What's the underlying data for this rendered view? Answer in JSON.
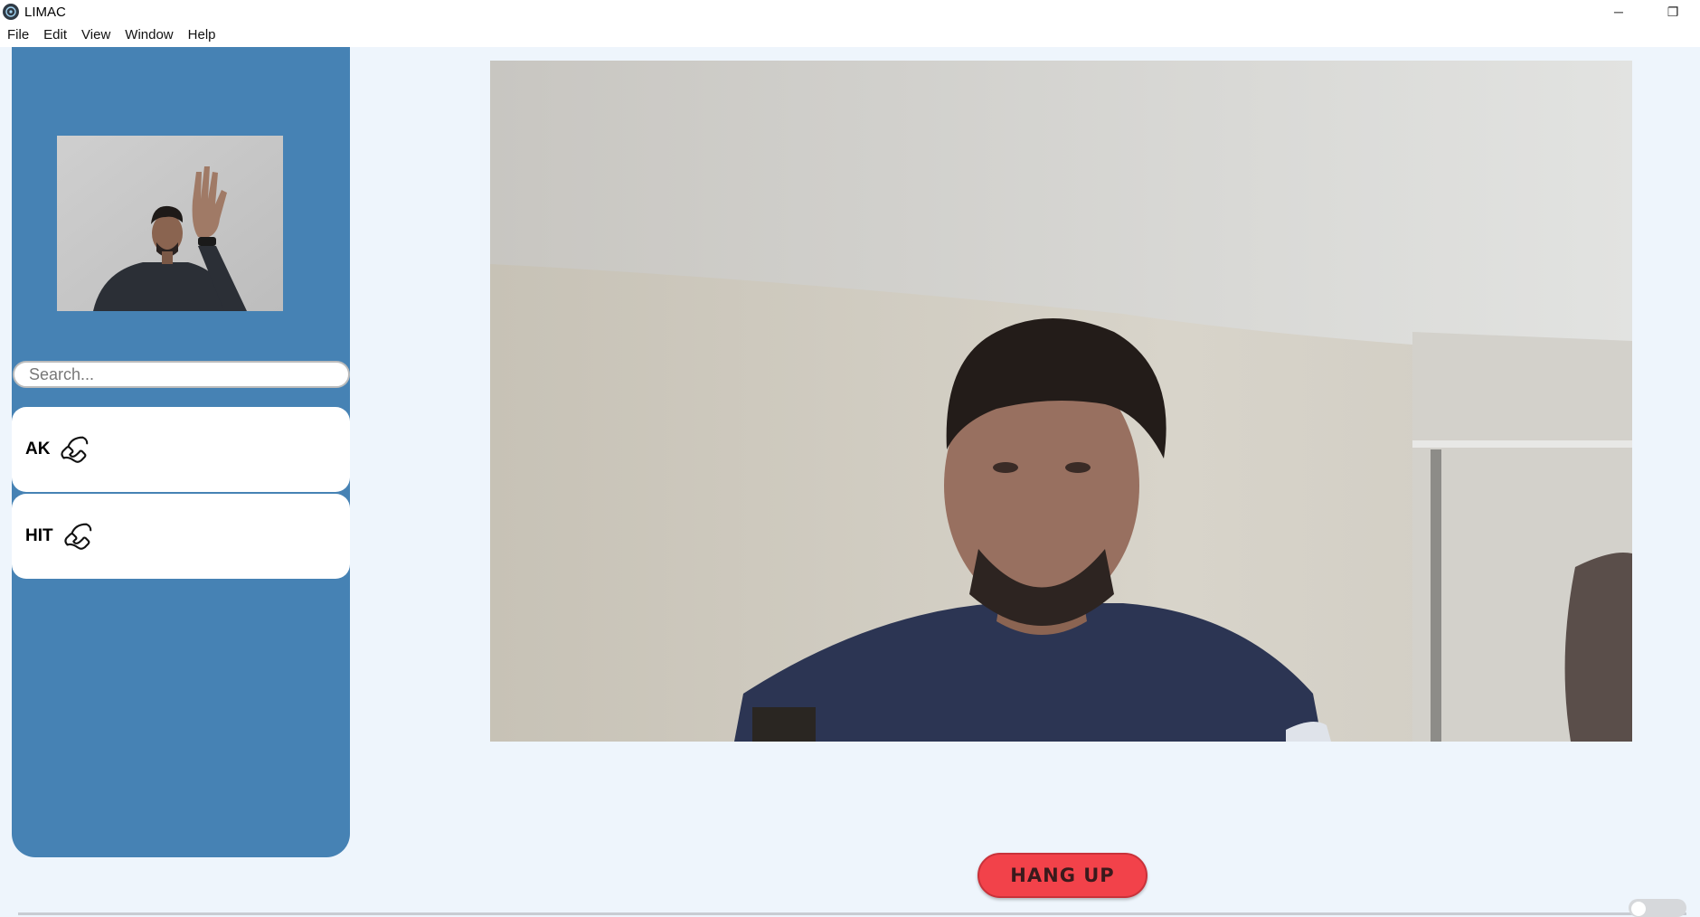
{
  "app": {
    "title": "LIMAC"
  },
  "window_controls": {
    "minimize": "─",
    "restore": "❐"
  },
  "menu": {
    "items": [
      "File",
      "Edit",
      "View",
      "Window",
      "Help"
    ]
  },
  "sidebar": {
    "search_placeholder": "Search...",
    "contacts": [
      {
        "name": "AK",
        "icon": "phone-icon"
      },
      {
        "name": "HIT",
        "icon": "phone-icon"
      }
    ]
  },
  "call": {
    "hangup_label": "HANG UP"
  },
  "colors": {
    "sidebar": "#4682b4",
    "background": "#eef5fc",
    "hangup": "#f2424a"
  }
}
